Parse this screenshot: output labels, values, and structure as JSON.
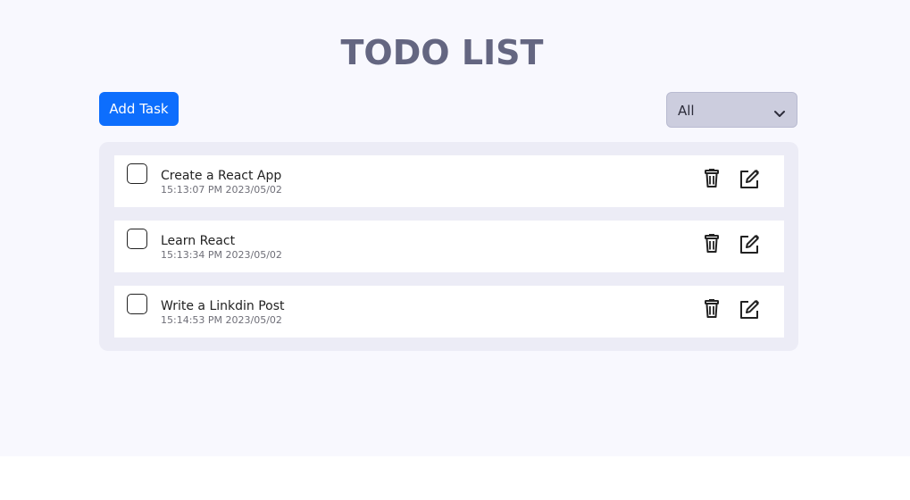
{
  "page": {
    "title": "TODO LIST"
  },
  "toolbar": {
    "add_label": "Add Task",
    "filter_value": "All",
    "filter_icon": "chevron-down-icon"
  },
  "tasks": [
    {
      "title": "Create a React App",
      "time": "15:13:07 PM 2023/05/02",
      "completed": false
    },
    {
      "title": "Learn React",
      "time": "15:13:34 PM 2023/05/02",
      "completed": false
    },
    {
      "title": "Write a Linkdin Post",
      "time": "15:14:53 PM 2023/05/02",
      "completed": false
    }
  ],
  "task_actions": {
    "delete_icon": "trash-icon",
    "edit_icon": "edit-icon"
  },
  "colors": {
    "accent": "#0d6efd",
    "title": "#646681",
    "background": "#f8f8fe",
    "panel": "#ececf6",
    "filter": "#cccdde"
  }
}
